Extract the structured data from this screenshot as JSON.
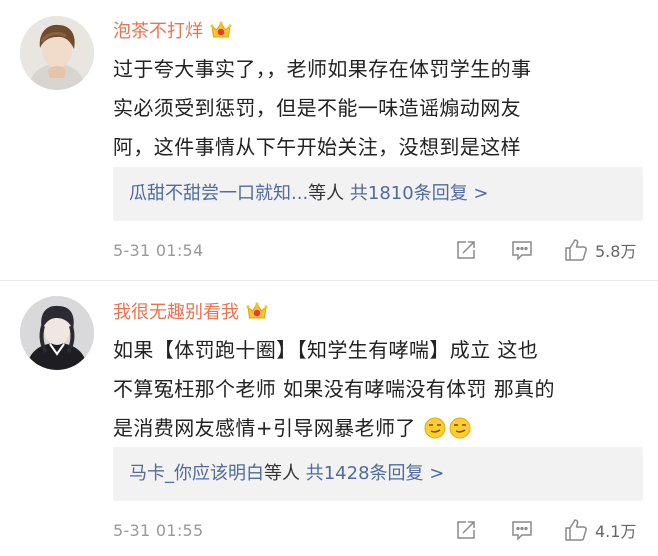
{
  "comments": [
    {
      "username": "泡茶不打烊",
      "content_lines": [
        "过于夸大事实了，，老师如果存在体罚学生的事",
        "实必须受到惩罚，但是不能一味造谣煽动网友",
        "阿，这件事情从下午开始关注，没想到是这样"
      ],
      "replies": {
        "names": "瓜甜不甜尝一口就知...",
        "by": "等人",
        "count_label": "共1810条回复 >"
      },
      "time": "5-31 01:54",
      "likes": "5.8万",
      "icons": {
        "forward": "share-icon",
        "comment": "comment-icon",
        "like": "thumbs-up-icon",
        "badge": "crown-badge-icon"
      }
    },
    {
      "username": "我很无趣别看我",
      "content_lines": [
        "如果【体罚跑十圈】【知学生有哮喘】成立 这也",
        "不算冤枉那个老师 如果没有哮喘没有体罚 那真的",
        "是消费网友感情+引导网暴老师了"
      ],
      "replies": {
        "names": "马卡_你应该明白",
        "by": "等人",
        "count_label": "共1428条回复 >"
      },
      "time": "5-31 01:55",
      "likes": "4.1万",
      "icons": {
        "forward": "share-icon",
        "comment": "comment-icon",
        "like": "thumbs-up-icon",
        "badge": "crown-badge-icon",
        "emoji": "smirk-emoji-icon"
      }
    }
  ],
  "colors": {
    "username": "#eb7350",
    "reply_link": "#506b9e",
    "meta": "#999999",
    "reply_bg": "#f2f2f2"
  }
}
